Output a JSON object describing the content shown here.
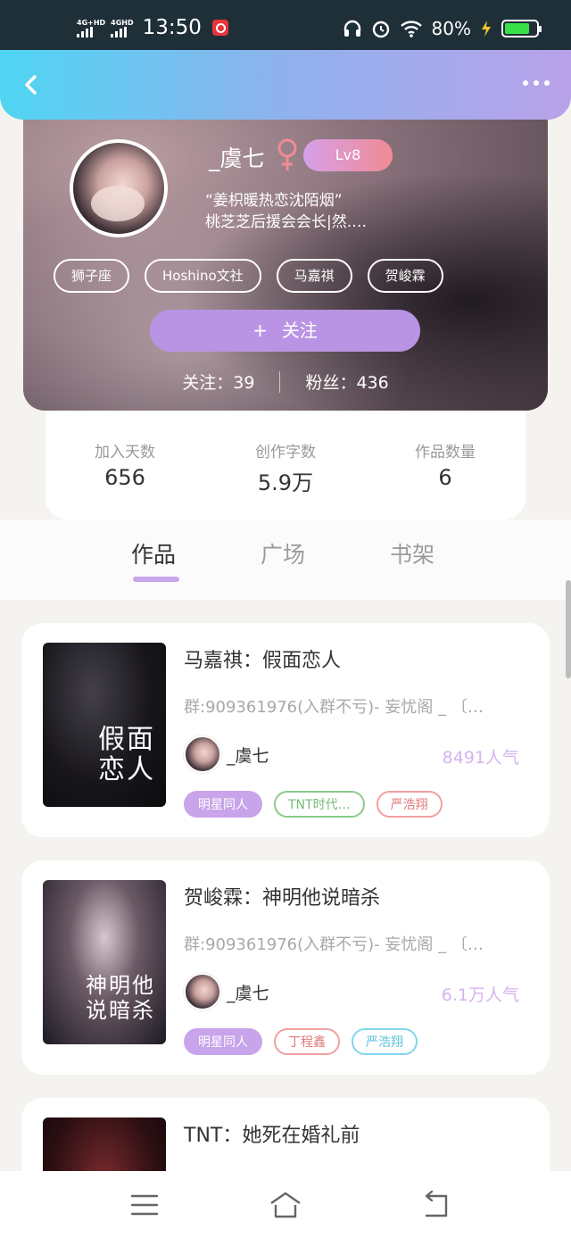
{
  "status_bar": {
    "signal1": "4G+HD",
    "signal2": "4GHD",
    "time": "13:50",
    "battery": "80%"
  },
  "profile": {
    "nickname": "_虞七",
    "level": "Lv8",
    "motto_line1": "“姜枳暖热恋沈陌烟”",
    "motto_line2": "桃芝芝后援会会长|然.…",
    "tags": [
      "狮子座",
      "Hoshino文社",
      "马嘉祺",
      "贺峻霖"
    ],
    "follow_label": "关注",
    "following": "关注：39",
    "fans": "粉丝：436"
  },
  "stats": [
    {
      "label": "加入天数",
      "value": "656"
    },
    {
      "label": "创作字数",
      "value": "5.9万"
    },
    {
      "label": "作品数量",
      "value": "6"
    }
  ],
  "tabs": [
    "作品",
    "广场",
    "书架"
  ],
  "works": [
    {
      "title": "马嘉祺：假面恋人",
      "desc": "群:909361976(入群不亏)- 妄忧阁 _ 〔…",
      "author": "_虞七",
      "popularity": "8491人气",
      "cover_text": "假面恋人",
      "tags": [
        {
          "label": "明星同人",
          "style": "purple"
        },
        {
          "label": "TNT时代…",
          "style": "green"
        },
        {
          "label": "严浩翔",
          "style": "red"
        }
      ]
    },
    {
      "title": "贺峻霖：神明他说暗杀",
      "desc": "群:909361976(入群不亏)- 妄忧阁 _ 〔…",
      "author": "_虞七",
      "popularity": "6.1万人气",
      "cover_text": "神明他说暗杀",
      "tags": [
        {
          "label": "明星同人",
          "style": "purple"
        },
        {
          "label": "丁程鑫",
          "style": "red"
        },
        {
          "label": "严浩翔",
          "style": "cyan"
        }
      ]
    },
    {
      "title": "TNT：她死在婚礼前"
    }
  ],
  "colors": {
    "header_start": "#4fd5f2",
    "header_end": "#b9a2ea",
    "accent_purple": "#b994e4",
    "popularity": "#d5b4ee"
  },
  "icons": {
    "back": "chevron-left-icon",
    "more": "more-dots-icon",
    "gender": "female-icon",
    "nav_menu": "menu-icon",
    "nav_home": "home-icon",
    "nav_back": "return-icon"
  }
}
